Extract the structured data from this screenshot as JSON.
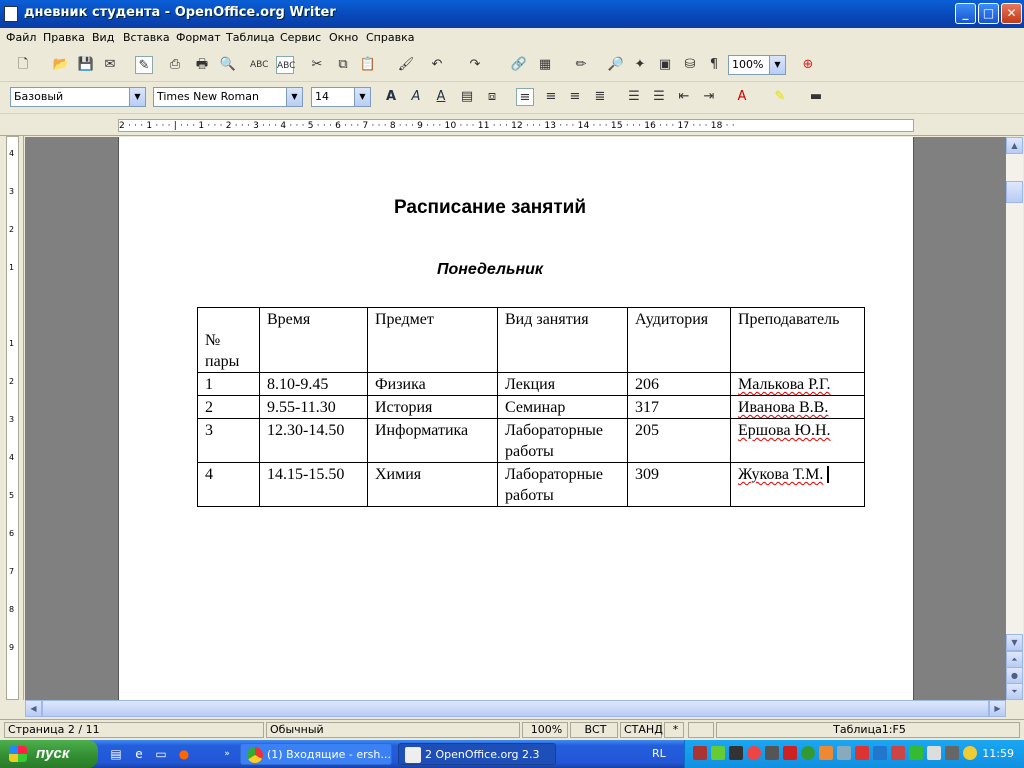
{
  "window": {
    "title": "дневник студента - OpenOffice.org Writer",
    "buttons": {
      "minimize": "_",
      "maximize": "□",
      "close": "✕"
    }
  },
  "menu": [
    "Файл",
    "Правка",
    "Вид",
    "Вставка",
    "Формат",
    "Таблица",
    "Сервис",
    "Окно",
    "Справка"
  ],
  "standard_toolbar": {
    "zoom": "100%"
  },
  "format_toolbar": {
    "style": "Базовый",
    "font": "Times New Roman",
    "size": "14"
  },
  "ruler": {
    "horizontal": "2 · · · 1 · · · | · · · 1 · · · 2 · · · 3 · · · 4 · · · 5 · · · 6 · · · 7 · · · 8 · · · 9 · · · 10 · · · 11 · · · 12 · · · 13 · · · 14 · · · 15 · · · 16 · · · 17 · · · 18 · ·",
    "vertical": [
      "4",
      "3",
      "2",
      "1",
      "1",
      "2",
      "3",
      "4",
      "5",
      "6",
      "7",
      "8",
      "9"
    ]
  },
  "document": {
    "title": "Расписание занятий",
    "subtitle": "Понедельник",
    "table": {
      "headers": [
        "№ пары",
        "Время",
        "Предмет",
        "Вид занятия",
        "Аудитория",
        "Преподаватель"
      ],
      "rows": [
        [
          "1",
          "8.10-9.45",
          "Физика",
          "Лекция",
          "206",
          "Малькова Р.Г."
        ],
        [
          "2",
          "9.55-11.30",
          "История",
          "Семинар",
          "317",
          "Иванова В.В."
        ],
        [
          "3",
          "12.30-14.50",
          "Информатика",
          "Лабораторные работы",
          "205",
          "Ершова Ю.Н."
        ],
        [
          "4",
          "14.15-15.50",
          "Химия",
          "Лабораторные работы",
          "309",
          "Жукова Т.М."
        ]
      ]
    }
  },
  "statusbar": {
    "page": "Страница  2 / 11",
    "style": "Обычный",
    "zoom": "100%",
    "mode_ins": "ВСТ",
    "mode_sel": "СТАНД",
    "modified": "*",
    "table_cell": "Таблица1:F5"
  },
  "taskbar": {
    "start": "пуск",
    "tasks": [
      "(1) Входящие - ersh...",
      "2 OpenOffice.org 2.3"
    ],
    "language": "RL",
    "clock": "11:59"
  },
  "colors": {
    "titlebar": "#0847b8",
    "spellcheck": "#e00000",
    "start": "#318e31"
  }
}
